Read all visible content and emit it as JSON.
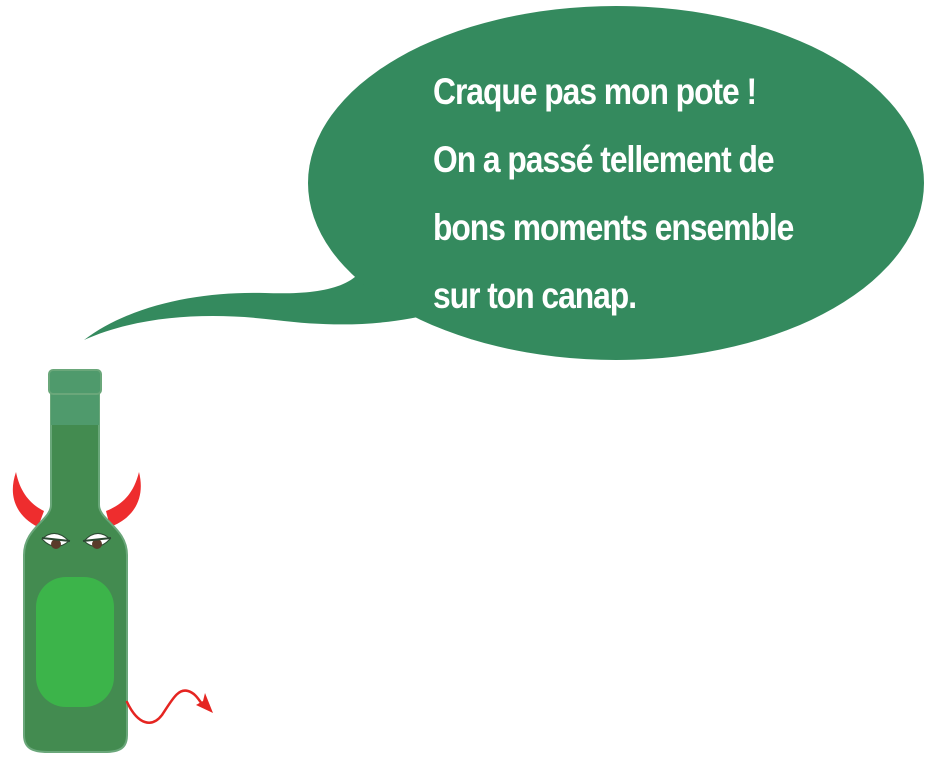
{
  "speech_bubble": {
    "lines": [
      "Craque pas mon pote !",
      "On a passé tellement de",
      "bons moments ensemble",
      "sur ton canap."
    ]
  },
  "colors": {
    "bubble": "#348a5e",
    "bottle_body": "#438b50",
    "bottle_outline": "#6aa77a",
    "bottle_cap": "#4f9a6c",
    "label": "#3cb44a",
    "horns": "#ee2d2e",
    "tail": "#e52521",
    "text": "#ffffff"
  },
  "icons": [
    "devil-bottle-character",
    "speech-bubble"
  ]
}
